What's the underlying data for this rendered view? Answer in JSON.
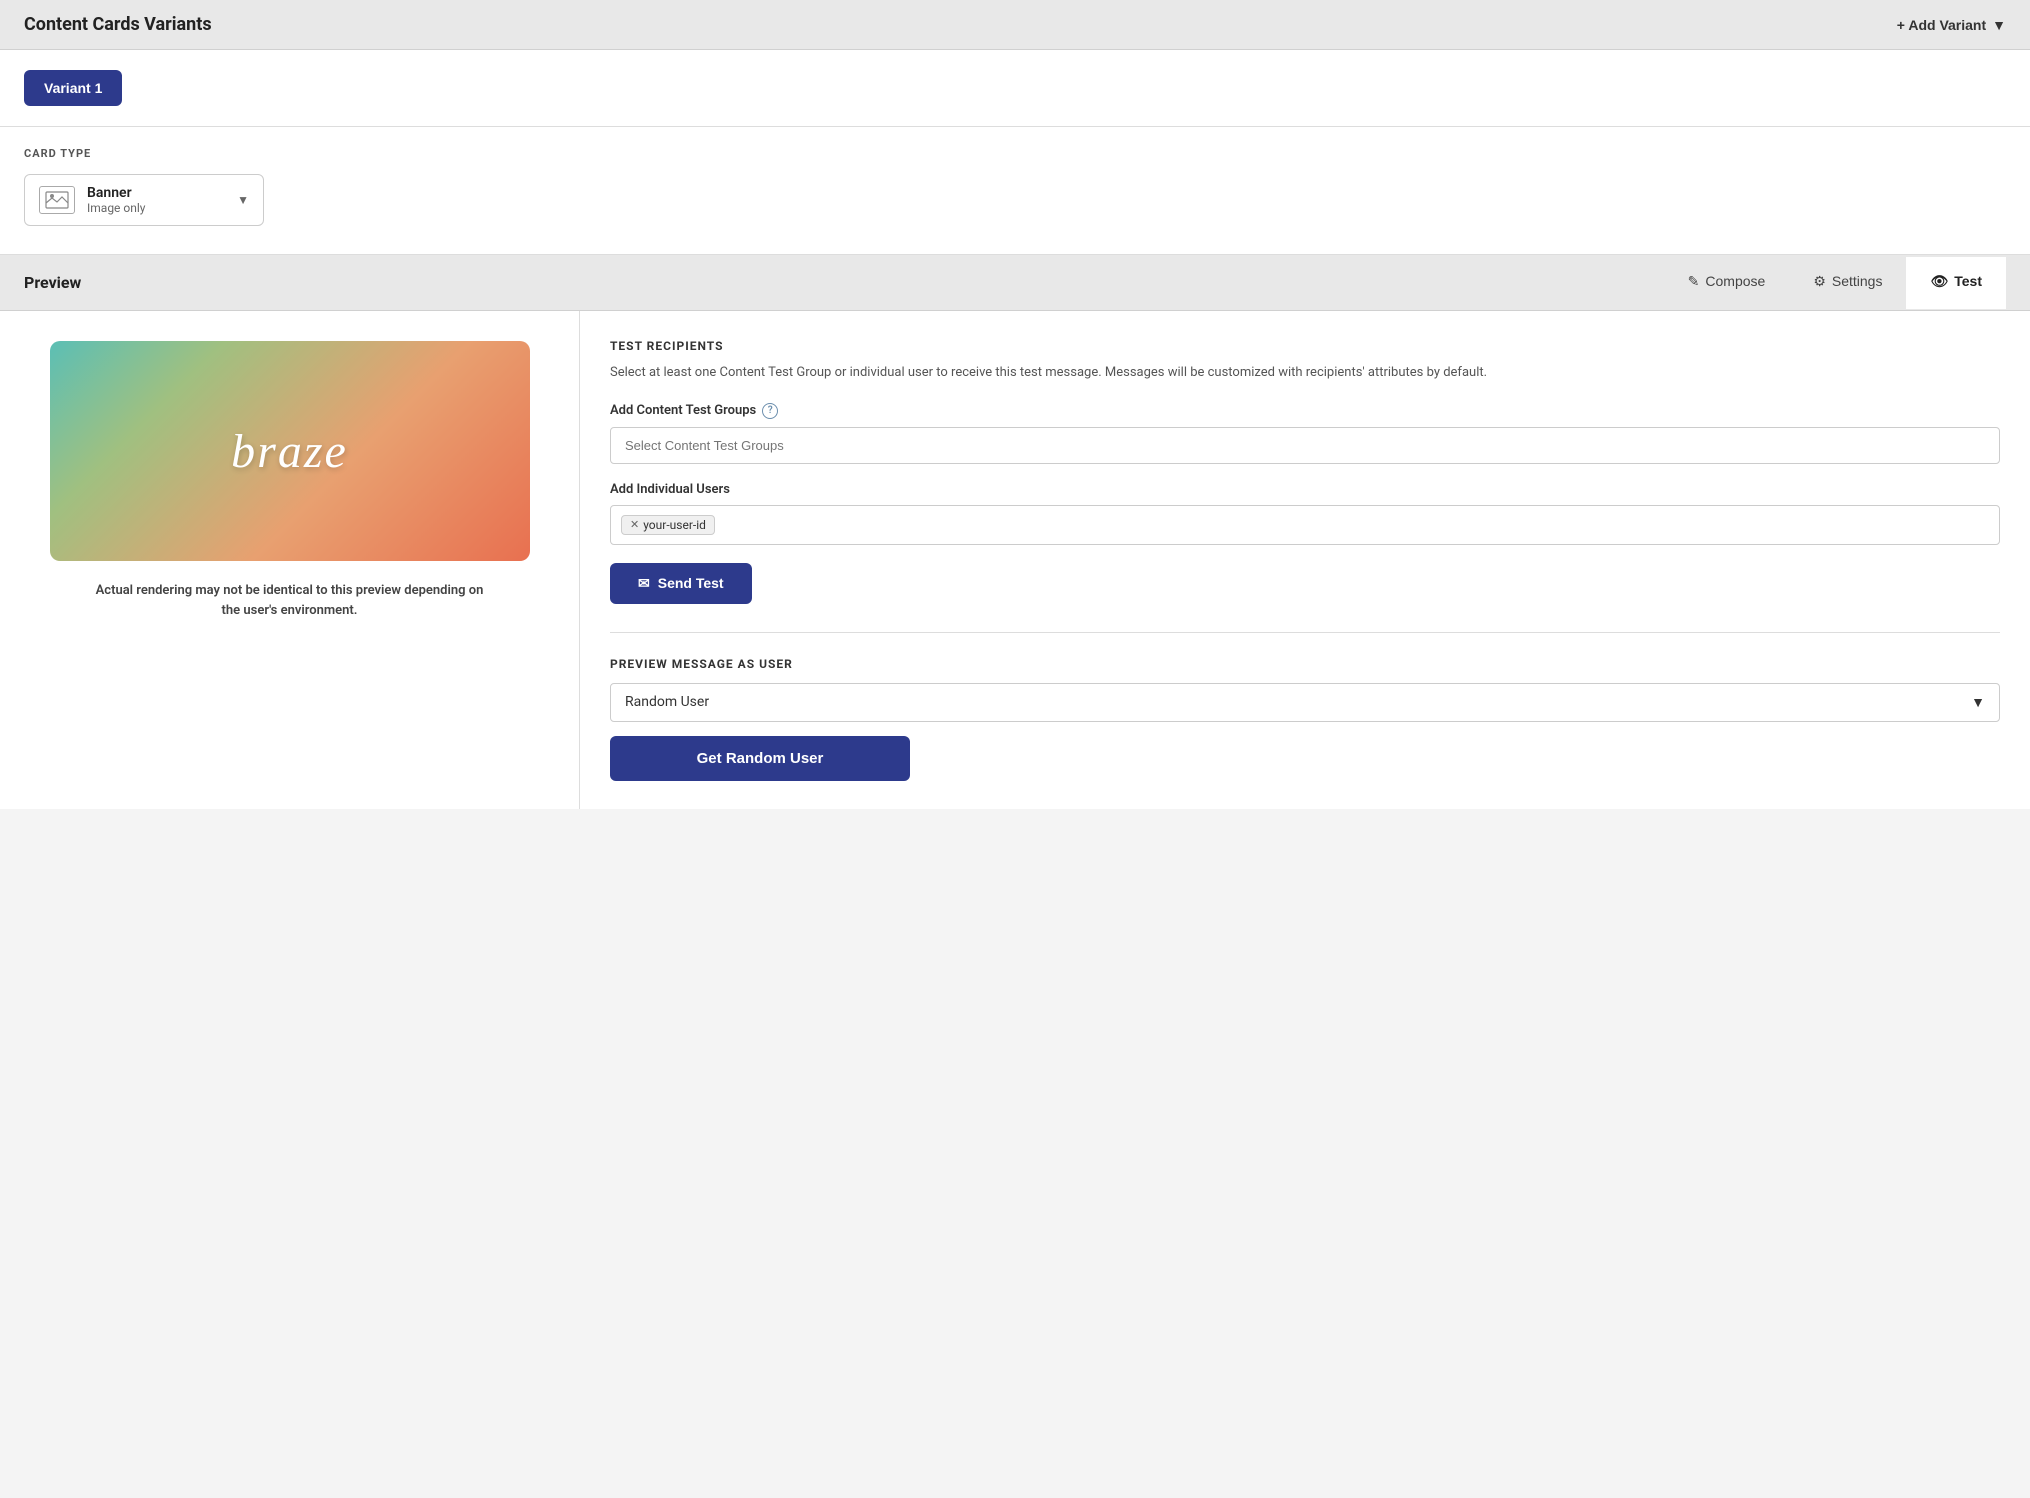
{
  "header": {
    "title": "Content Cards Variants",
    "add_variant_label": "+ Add Variant"
  },
  "variant": {
    "button_label": "Variant 1"
  },
  "card_type": {
    "section_label": "CARD TYPE",
    "name": "Banner",
    "sub": "Image only"
  },
  "preview_section": {
    "label": "Preview"
  },
  "tabs": [
    {
      "id": "compose",
      "label": "Compose",
      "icon": "pencil"
    },
    {
      "id": "settings",
      "label": "Settings",
      "icon": "gear"
    },
    {
      "id": "test",
      "label": "Test",
      "icon": "eye",
      "active": true
    }
  ],
  "preview_panel": {
    "braze_text": "braze",
    "notice": "Actual rendering may not be identical to this preview depending on the user's environment."
  },
  "test_panel": {
    "recipients_title": "TEST RECIPIENTS",
    "recipients_desc": "Select at least one Content Test Group or individual user to receive this test message. Messages will be customized with recipients' attributes by default.",
    "add_groups_label": "Add Content Test Groups",
    "groups_placeholder": "Select Content Test Groups",
    "add_users_label": "Add Individual Users",
    "user_tag": "your-user-id",
    "send_test_label": "Send Test",
    "preview_message_label": "PREVIEW MESSAGE AS USER",
    "random_user_value": "Random User",
    "get_random_user_label": "Get Random User"
  }
}
